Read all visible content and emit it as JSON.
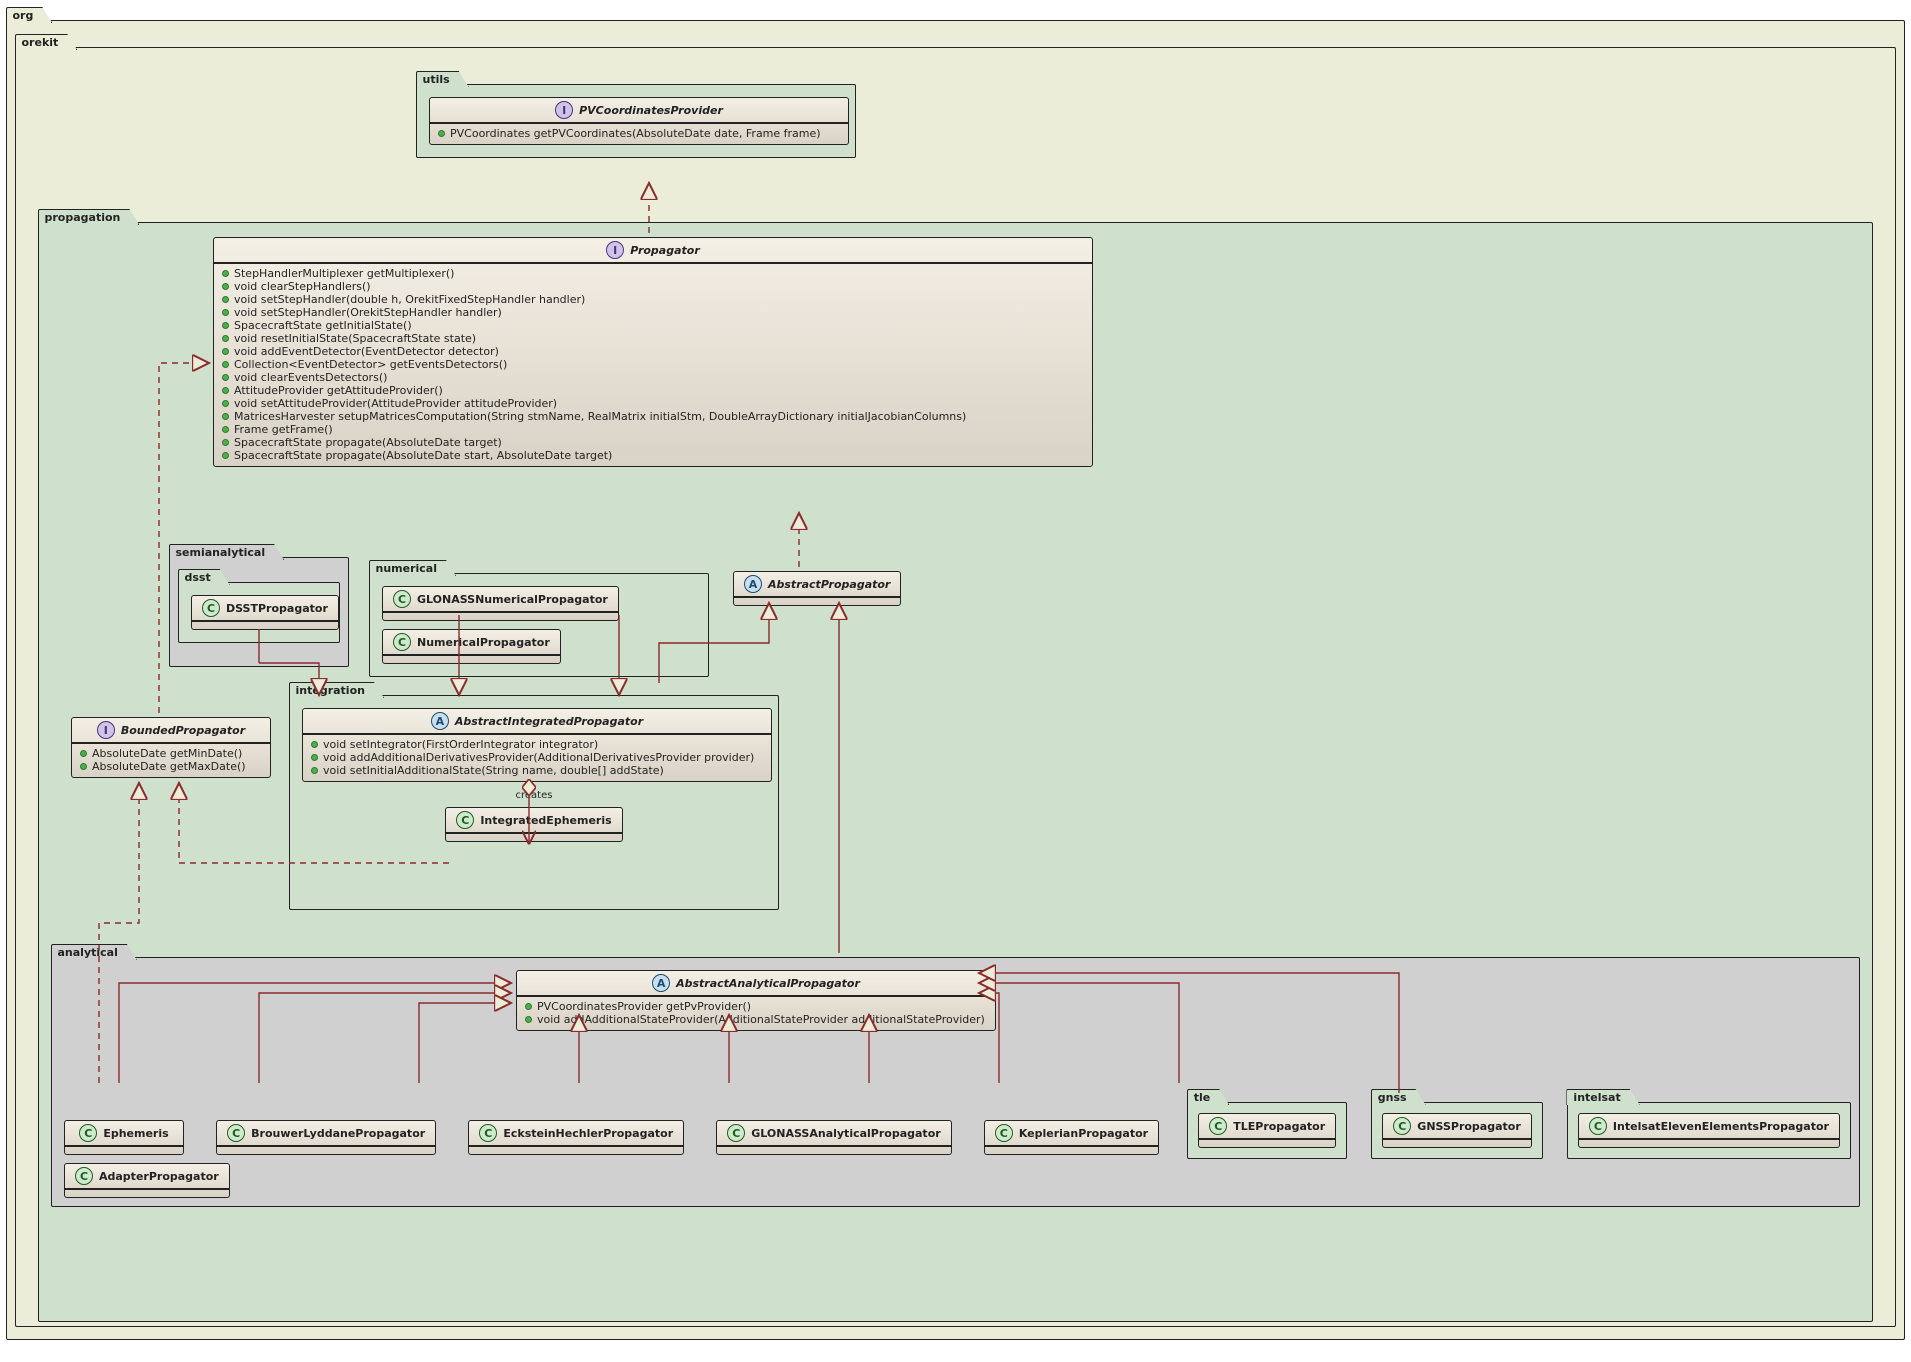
{
  "packages": {
    "org": "org",
    "orekit": "orekit",
    "utils": "utils",
    "propagation": "propagation",
    "semianalytical": "semianalytical",
    "dsst": "dsst",
    "numerical": "numerical",
    "integration": "integration",
    "analytical": "analytical",
    "tle": "tle",
    "gnss": "gnss",
    "intelsat": "intelsat"
  },
  "badges": {
    "I": "I",
    "A": "A",
    "C": "C"
  },
  "classes": {
    "PVCoordinatesProvider": {
      "name": "PVCoordinatesProvider",
      "stereotype": "I",
      "members": [
        "PVCoordinates getPVCoordinates(AbsoluteDate date, Frame frame)"
      ]
    },
    "Propagator": {
      "name": "Propagator",
      "stereotype": "I",
      "members": [
        "StepHandlerMultiplexer getMultiplexer()",
        "void clearStepHandlers()",
        "void setStepHandler(double h, OrekitFixedStepHandler handler)",
        "void setStepHandler(OrekitStepHandler handler)",
        "SpacecraftState getInitialState()",
        "void resetInitialState(SpacecraftState state)",
        "void addEventDetector(EventDetector detector)",
        "Collection<EventDetector> getEventsDetectors()",
        "void clearEventsDetectors()",
        "AttitudeProvider getAttitudeProvider()",
        "void setAttitudeProvider(AttitudeProvider attitudeProvider)",
        "MatricesHarvester setupMatricesComputation(String stmName, RealMatrix initialStm, DoubleArrayDictionary initialJacobianColumns)",
        "Frame getFrame()",
        "SpacecraftState propagate(AbsoluteDate target)",
        "SpacecraftState propagate(AbsoluteDate start, AbsoluteDate target)"
      ]
    },
    "BoundedPropagator": {
      "name": "BoundedPropagator",
      "stereotype": "I",
      "members": [
        "AbsoluteDate getMinDate()",
        "AbsoluteDate getMaxDate()"
      ]
    },
    "DSSTPropagator": {
      "name": "DSSTPropagator",
      "stereotype": "C",
      "members": []
    },
    "GLONASSNumericalPropagator": {
      "name": "GLONASSNumericalPropagator",
      "stereotype": "C",
      "members": []
    },
    "NumericalPropagator": {
      "name": "NumericalPropagator",
      "stereotype": "C",
      "members": []
    },
    "AbstractPropagator": {
      "name": "AbstractPropagator",
      "stereotype": "A",
      "members": []
    },
    "AbstractIntegratedPropagator": {
      "name": "AbstractIntegratedPropagator",
      "stereotype": "A",
      "members": [
        "void setIntegrator(FirstOrderIntegrator integrator)",
        "void addAdditionalDerivativesProvider(AdditionalDerivativesProvider provider)",
        "void setInitialAdditionalState(String name, double[] addState)"
      ]
    },
    "IntegratedEphemeris": {
      "name": "IntegratedEphemeris",
      "stereotype": "C",
      "members": []
    },
    "AbstractAnalyticalPropagator": {
      "name": "AbstractAnalyticalPropagator",
      "stereotype": "A",
      "members": [
        "PVCoordinatesProvider getPvProvider()",
        "void addAdditionalStateProvider(AdditionalStateProvider additionalStateProvider)"
      ]
    },
    "Ephemeris": {
      "name": "Ephemeris",
      "stereotype": "C",
      "members": []
    },
    "BrouwerLyddanePropagator": {
      "name": "BrouwerLyddanePropagator",
      "stereotype": "C",
      "members": []
    },
    "EcksteinHechlerPropagator": {
      "name": "EcksteinHechlerPropagator",
      "stereotype": "C",
      "members": []
    },
    "GLONASSAnalyticalPropagator": {
      "name": "GLONASSAnalyticalPropagator",
      "stereotype": "C",
      "members": []
    },
    "KeplerianPropagator": {
      "name": "KeplerianPropagator",
      "stereotype": "C",
      "members": []
    },
    "TLEPropagator": {
      "name": "TLEPropagator",
      "stereotype": "C",
      "members": []
    },
    "GNSSPropagator": {
      "name": "GNSSPropagator",
      "stereotype": "C",
      "members": []
    },
    "IntelsatElevenElementsPropagator": {
      "name": "IntelsatElevenElementsPropagator",
      "stereotype": "C",
      "members": []
    },
    "AdapterPropagator": {
      "name": "AdapterPropagator",
      "stereotype": "C",
      "members": []
    }
  },
  "labels": {
    "creates": "creates"
  },
  "relations_doc": [
    "Propagator --|> PVCoordinatesProvider (realization, dashed)",
    "BoundedPropagator --|> Propagator (realization, dashed)",
    "AbstractPropagator ..|> Propagator (realization, dashed)",
    "AbstractIntegratedPropagator --|> AbstractPropagator (generalization)",
    "DSSTPropagator --|> AbstractIntegratedPropagator",
    "GLONASSNumericalPropagator --|> AbstractIntegratedPropagator",
    "NumericalPropagator --|> AbstractIntegratedPropagator",
    "AbstractIntegratedPropagator --> IntegratedEphemeris : creates (aggregation/creates)",
    "IntegratedEphemeris ..|> BoundedPropagator (dashed)",
    "AbstractAnalyticalPropagator --|> AbstractPropagator",
    "Ephemeris --|> AbstractAnalyticalPropagator",
    "Ephemeris ..|> BoundedPropagator (dashed)",
    "BrouwerLyddanePropagator --|> AbstractAnalyticalPropagator",
    "EcksteinHechlerPropagator --|> AbstractAnalyticalPropagator",
    "GLONASSAnalyticalPropagator --|> AbstractAnalyticalPropagator",
    "KeplerianPropagator --|> AbstractAnalyticalPropagator",
    "TLEPropagator --|> AbstractAnalyticalPropagator",
    "GNSSPropagator --|> AbstractAnalyticalPropagator",
    "IntelsatElevenElementsPropagator --|> AbstractAnalyticalPropagator",
    "AdapterPropagator --|> AbstractAnalyticalPropagator"
  ]
}
